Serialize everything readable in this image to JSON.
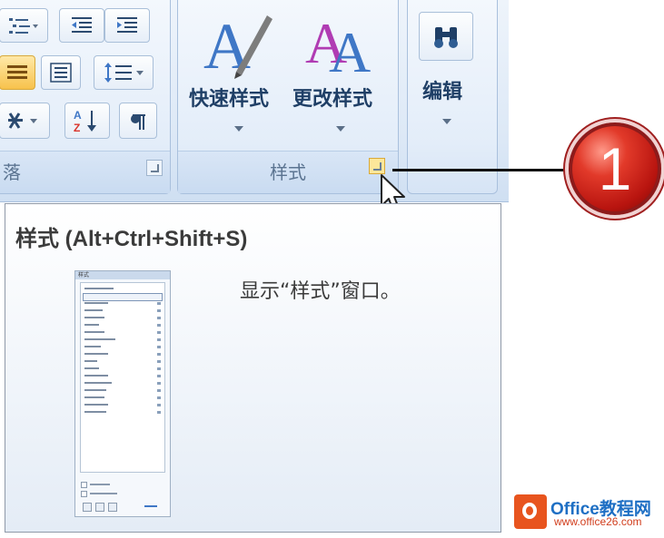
{
  "ribbon": {
    "paragraph_group": {
      "label_partial": "落",
      "sort_icon_text": "A Z"
    },
    "styles_group": {
      "label": "样式",
      "quick_styles_label": "快速样式",
      "change_styles_label": "更改样式"
    },
    "editing_group": {
      "label": "编辑"
    }
  },
  "tooltip": {
    "title": "样式 (Alt+Ctrl+Shift+S)",
    "description": "显示“样式”窗口。",
    "thumbnail_header": "样式"
  },
  "callout": {
    "number": "1"
  },
  "watermark": {
    "title": "Office教程网",
    "url": "www.office26.com"
  },
  "colors": {
    "callout_red": "#b8140f",
    "ribbon_blue": "#dce8f6",
    "accent_letter_blue": "#3f77c6",
    "accent_letter_purple": "#b03cb3"
  }
}
